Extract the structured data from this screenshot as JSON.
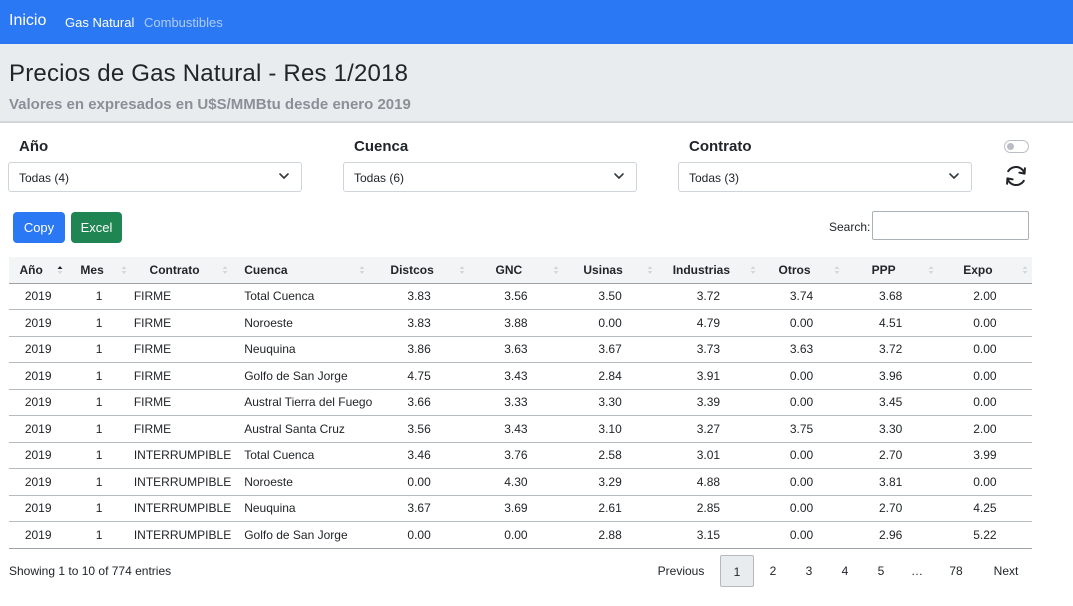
{
  "nav": {
    "brand": "Inicio",
    "links": [
      "Gas Natural",
      "Combustibles"
    ]
  },
  "hero": {
    "title": "Precios de Gas Natural - Res 1/2018",
    "subtitle": "Valores en expresados en U$S/MMBtu desde enero 2019"
  },
  "filters": {
    "anio": {
      "label": "Año",
      "value": "Todas (4)"
    },
    "cuenca": {
      "label": "Cuenca",
      "value": "Todas (6)"
    },
    "contrato": {
      "label": "Contrato",
      "value": "Todas (3)"
    }
  },
  "buttons": {
    "copy": "Copy",
    "excel": "Excel"
  },
  "search": {
    "label": "Search:",
    "value": ""
  },
  "table": {
    "headers": [
      "Año",
      "Mes",
      "Contrato",
      "Cuenca",
      "Distcos",
      "GNC",
      "Usinas",
      "Industrias",
      "Otros",
      "PPP",
      "Expo"
    ],
    "rows": [
      [
        "2019",
        "1",
        "FIRME",
        "Total Cuenca",
        "3.83",
        "3.56",
        "3.50",
        "3.72",
        "3.74",
        "3.68",
        "2.00"
      ],
      [
        "2019",
        "1",
        "FIRME",
        "Noroeste",
        "3.83",
        "3.88",
        "0.00",
        "4.79",
        "0.00",
        "4.51",
        "0.00"
      ],
      [
        "2019",
        "1",
        "FIRME",
        "Neuquina",
        "3.86",
        "3.63",
        "3.67",
        "3.73",
        "3.63",
        "3.72",
        "0.00"
      ],
      [
        "2019",
        "1",
        "FIRME",
        "Golfo de San Jorge",
        "4.75",
        "3.43",
        "2.84",
        "3.91",
        "0.00",
        "3.96",
        "0.00"
      ],
      [
        "2019",
        "1",
        "FIRME",
        "Austral Tierra del Fuego",
        "3.66",
        "3.33",
        "3.30",
        "3.39",
        "0.00",
        "3.45",
        "0.00"
      ],
      [
        "2019",
        "1",
        "FIRME",
        "Austral Santa Cruz",
        "3.56",
        "3.43",
        "3.10",
        "3.27",
        "3.75",
        "3.30",
        "2.00"
      ],
      [
        "2019",
        "1",
        "INTERRUMPIBLE",
        "Total Cuenca",
        "3.46",
        "3.76",
        "2.58",
        "3.01",
        "0.00",
        "2.70",
        "3.99"
      ],
      [
        "2019",
        "1",
        "INTERRUMPIBLE",
        "Noroeste",
        "0.00",
        "4.30",
        "3.29",
        "4.88",
        "0.00",
        "3.81",
        "0.00"
      ],
      [
        "2019",
        "1",
        "INTERRUMPIBLE",
        "Neuquina",
        "3.67",
        "3.69",
        "2.61",
        "2.85",
        "0.00",
        "2.70",
        "4.25"
      ],
      [
        "2019",
        "1",
        "INTERRUMPIBLE",
        "Golfo de San Jorge",
        "0.00",
        "0.00",
        "2.88",
        "3.15",
        "0.00",
        "2.96",
        "5.22"
      ]
    ]
  },
  "footer": {
    "info": "Showing 1 to 10 of 774 entries",
    "previous": "Previous",
    "pages": [
      "1",
      "2",
      "3",
      "4",
      "5",
      "…",
      "78"
    ],
    "next": "Next"
  },
  "colors": {
    "navbar": "#2b78f5",
    "copy_button": "#2b78f5",
    "excel_button": "#1f8553",
    "hero_background": "#e9ecef"
  }
}
